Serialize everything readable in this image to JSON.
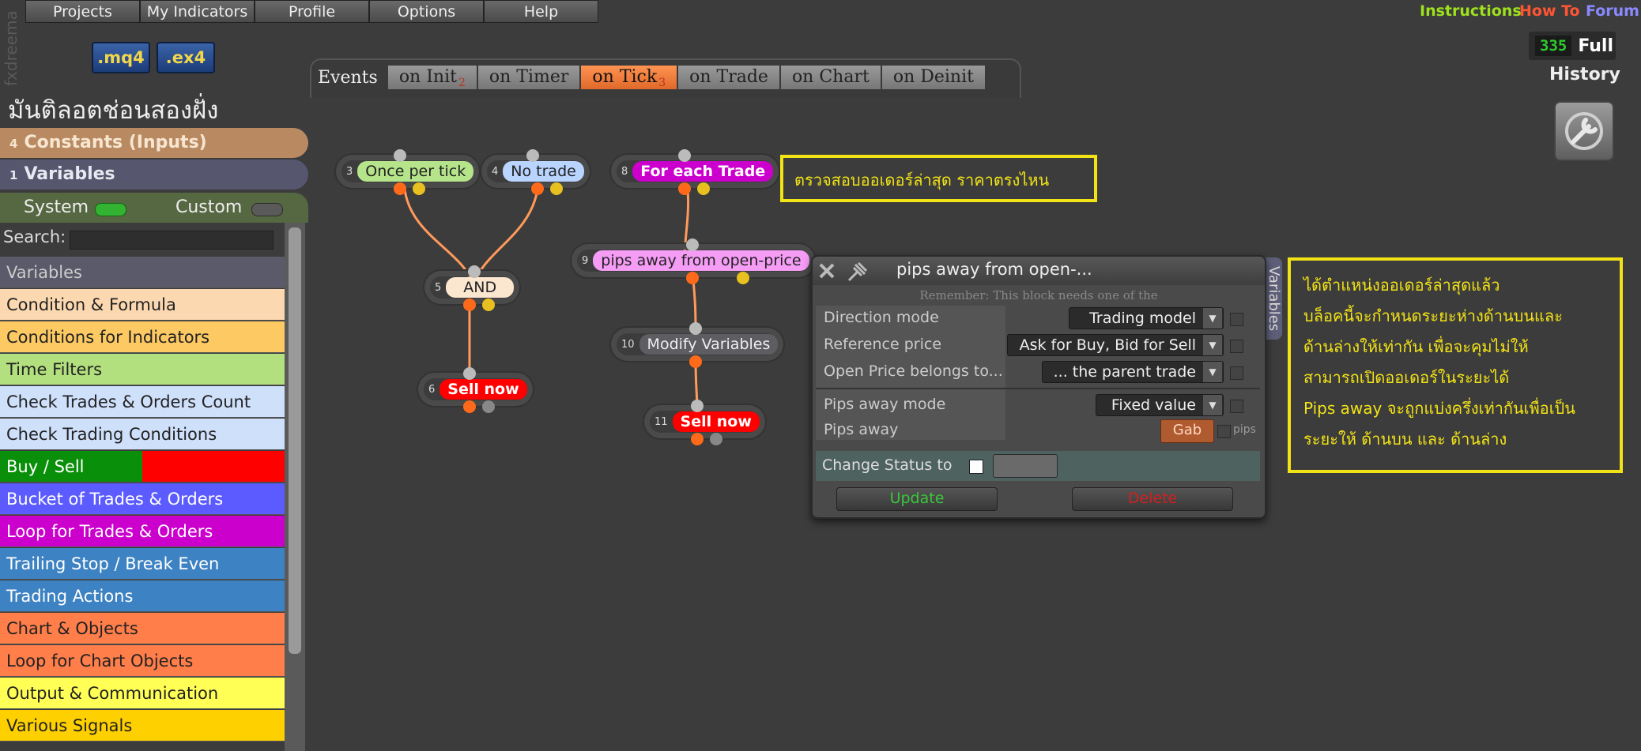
{
  "app": {
    "brand": "fxdreema",
    "project_title": "มันติลอตช่อนสองฝั่ง"
  },
  "menu": [
    "Projects",
    "My Indicators",
    "Profile",
    "Options",
    "Help"
  ],
  "export_buttons": {
    "mq4": ".mq4",
    "ex4": ".ex4"
  },
  "top_links": {
    "instructions": "Instructions",
    "howto": "How To",
    "forum": "Forum",
    "colors": {
      "instructions": "#9ee21d",
      "howto": "#ff5533",
      "forum": "#8a8aff"
    }
  },
  "counter": {
    "value": "335",
    "label": "Full"
  },
  "history": "History",
  "events": {
    "label": "Events",
    "tabs": [
      {
        "label": "on Init",
        "sub": "2",
        "active": false
      },
      {
        "label": "on Timer",
        "sub": "",
        "active": false
      },
      {
        "label": "on Tick",
        "sub": "3",
        "active": true
      },
      {
        "label": "on Trade",
        "sub": "",
        "active": false
      },
      {
        "label": "on Chart",
        "sub": "",
        "active": false
      },
      {
        "label": "on Deinit",
        "sub": "",
        "active": false
      }
    ]
  },
  "sidebar": {
    "constants": {
      "num": "4",
      "label": "Constants (Inputs)"
    },
    "variables": {
      "num": "1",
      "label": "Variables"
    },
    "system": "System",
    "custom": "Custom",
    "search_label": "Search:",
    "categories": [
      {
        "label": "Variables",
        "bg": "#5a5a6a",
        "fg": "#ccc"
      },
      {
        "label": "Condition & Formula",
        "bg": "#fbd8b0",
        "fg": "#222"
      },
      {
        "label": "Conditions for Indicators",
        "bg": "#fdc963",
        "fg": "#222"
      },
      {
        "label": "Time Filters",
        "bg": "#b3e07f",
        "fg": "#222"
      },
      {
        "label": "Check Trades & Orders Count",
        "bg": "#cfe0fb",
        "fg": "#222"
      },
      {
        "label": "Check Trading Conditions",
        "bg": "#cfe0fb",
        "fg": "#222"
      },
      {
        "label": "Buy / Sell",
        "bg": "#0a8f0a",
        "fg": "#fff",
        "bg2": "#ff0000"
      },
      {
        "label": "Bucket of Trades & Orders",
        "bg": "#5b5bff",
        "fg": "#fff"
      },
      {
        "label": "Loop for Trades & Orders",
        "bg": "#cc00cc",
        "fg": "#fff"
      },
      {
        "label": "Trailing Stop / Break Even",
        "bg": "#3d82c2",
        "fg": "#fff"
      },
      {
        "label": "Trading Actions",
        "bg": "#3d82c2",
        "fg": "#fff"
      },
      {
        "label": "Chart & Objects",
        "bg": "#ff7e4a",
        "fg": "#222"
      },
      {
        "label": "Loop for Chart Objects",
        "bg": "#ff7e4a",
        "fg": "#222"
      },
      {
        "label": "Output & Communication",
        "bg": "#ffff55",
        "fg": "#222"
      },
      {
        "label": "Various Signals",
        "bg": "#ffd000",
        "fg": "#222"
      }
    ]
  },
  "nodes": {
    "n3": {
      "num": "3",
      "label": "Once per tick",
      "bg": "#b5e48a",
      "fg": "#222"
    },
    "n4": {
      "num": "4",
      "label": "No trade",
      "bg": "#b8d4ff",
      "fg": "#222"
    },
    "n5": {
      "num": "5",
      "label": "AND",
      "bg": "#fbe6d0",
      "fg": "#222"
    },
    "n6": {
      "num": "6",
      "label": "Sell now",
      "bg": "#ff0000",
      "fg": "#fff"
    },
    "n8": {
      "num": "8",
      "label": "For each Trade",
      "bg": "#cc00cc",
      "fg": "#fff"
    },
    "n9": {
      "num": "9",
      "label": "pips away from open-price",
      "bg": "#f59cf5",
      "fg": "#222"
    },
    "n10": {
      "num": "10",
      "label": "Modify Variables",
      "bg": "#5e5e62",
      "fg": "#eee"
    },
    "n11": {
      "num": "11",
      "label": "Sell now",
      "bg": "#ff0000",
      "fg": "#fff"
    }
  },
  "notes": {
    "note1": "ตรวจสอบออเดอร์ล่าสุด ราคาตรงไหน",
    "note2": [
      "ได้ตำแหน่งออเดอร์ล่าสุดแล้ว",
      "บล็อคนี้จะกำหนดระยะห่างด้านบนและ",
      "ด้านล่างให้เท่ากัน เพื่อจะคุมไม่ให้",
      "สามารถเปิดออเดอร์ในระยะได้",
      "Pips away จะถูกแบ่งครึ่งเท่ากันเพื่อเป็น",
      "ระยะให้ ด้านบน และ ด้านล่าง"
    ]
  },
  "dialog": {
    "title": "pips away from open-...",
    "remember": "Remember: This block needs one of the",
    "rows": [
      {
        "label": "Direction mode",
        "value": "Trading model"
      },
      {
        "label": "Reference price",
        "value": "Ask for Buy, Bid for Sell"
      },
      {
        "label": "Open Price belongs to...",
        "value": "... the parent trade"
      },
      {
        "label": "Pips away mode",
        "value": "Fixed value"
      },
      {
        "label": "Pips away",
        "value": "Gab",
        "unit": "pips"
      }
    ],
    "change_status": "Change Status to",
    "update": "Update",
    "delete": "Delete",
    "variables_tab": "Variables"
  }
}
